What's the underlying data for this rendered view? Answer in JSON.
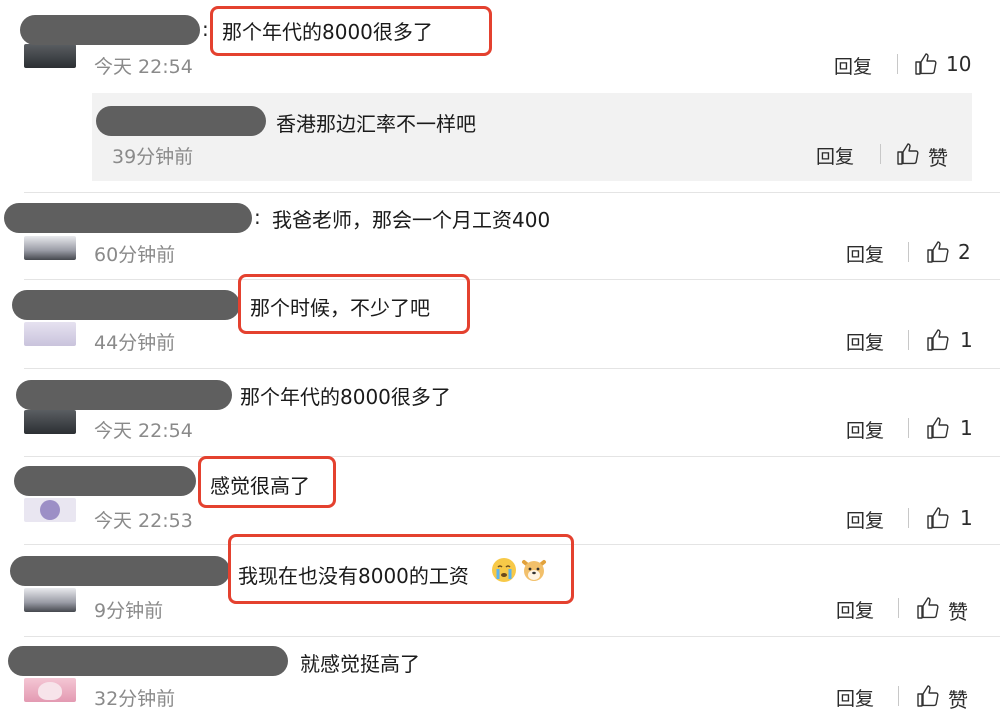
{
  "comments": [
    {
      "content": "那个年代的8000很多了",
      "time": "今天 22:54",
      "reply": "回复",
      "likes": "10"
    },
    {
      "content": "香港那边汇率不一样吧",
      "time": "39分钟前",
      "reply": "回复",
      "likes": "赞"
    },
    {
      "content": "我爸老师，那会一个月工资400",
      "time": "60分钟前",
      "reply": "回复",
      "likes": "2"
    },
    {
      "content": "那个时候，不少了吧",
      "time": "44分钟前",
      "reply": "回复",
      "likes": "1"
    },
    {
      "content": "那个年代的8000很多了",
      "time": "今天 22:54",
      "reply": "回复",
      "likes": "1"
    },
    {
      "content": "感觉很高了",
      "time": "今天 22:53",
      "reply": "回复",
      "likes": "1"
    },
    {
      "content": "我现在也没有8000的工资",
      "time": "9分钟前",
      "reply": "回复",
      "likes": "赞"
    },
    {
      "content": "就感觉挺高了",
      "time": "32分钟前",
      "reply": "回复",
      "likes": "赞"
    }
  ],
  "colon": ":",
  "icons": {
    "like": "thumbs-up-icon",
    "emoji_cry": "crying-face-emoji",
    "emoji_dog": "dog-face-emoji"
  },
  "colors": {
    "highlight": "#e4412f",
    "subreply_bg": "#f2f2f2",
    "meta": "#8a8a8a"
  }
}
